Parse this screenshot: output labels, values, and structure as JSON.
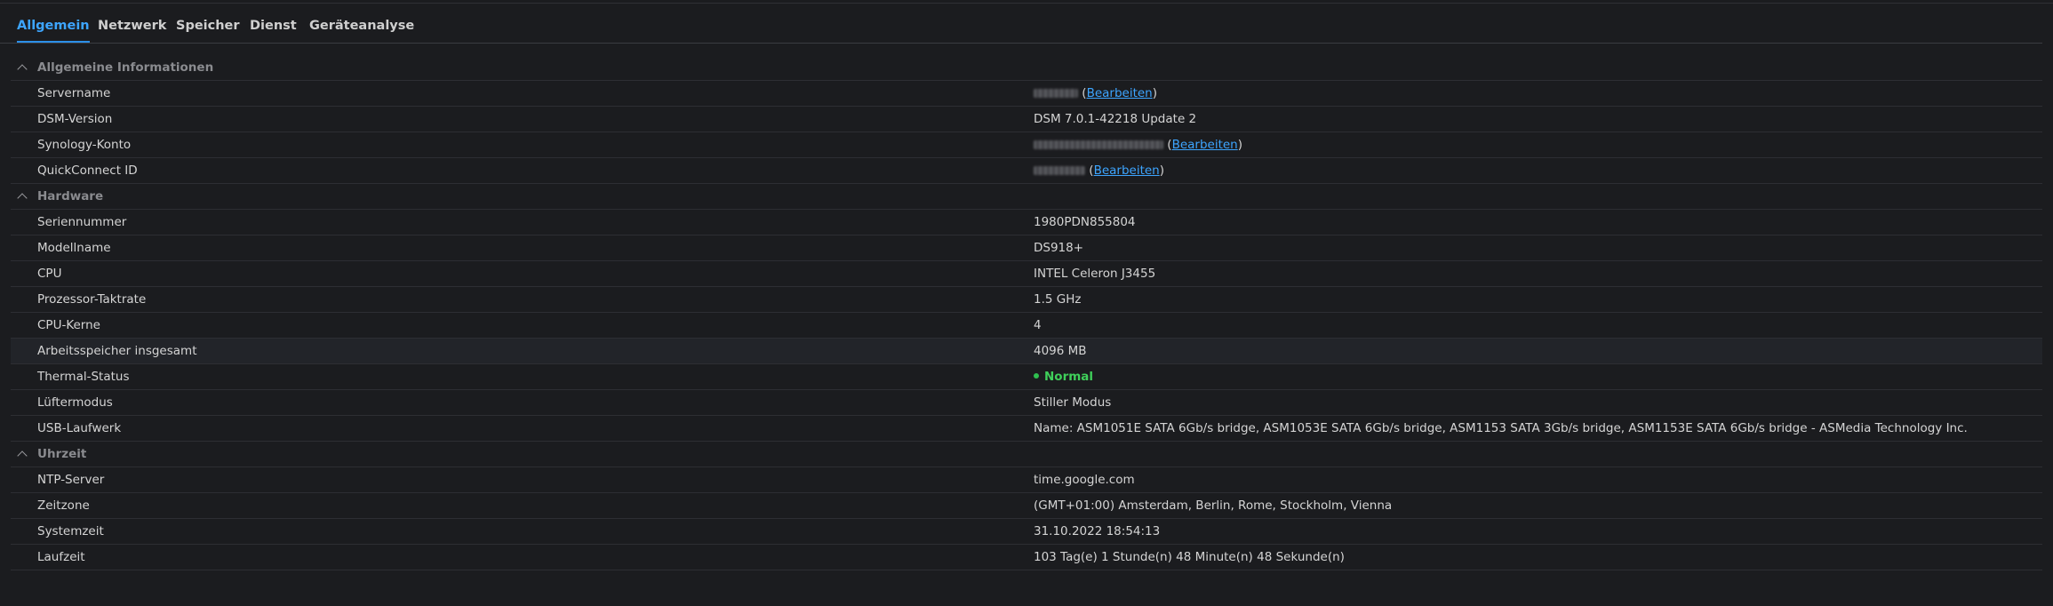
{
  "tabs": [
    {
      "label": "Allgemein",
      "active": true
    },
    {
      "label": "Netzwerk",
      "active": false
    },
    {
      "label": "Speicher",
      "active": false
    },
    {
      "label": "Dienst",
      "active": false
    },
    {
      "label": "Geräteanalyse",
      "active": false
    }
  ],
  "edit_label": "Bearbeiten",
  "sections": {
    "general": {
      "title": "Allgemeine Informationen",
      "rows": {
        "servername": {
          "label": "Servername"
        },
        "dsm": {
          "label": "DSM-Version",
          "value": "DSM 7.0.1-42218 Update 2"
        },
        "synology": {
          "label": "Synology-Konto"
        },
        "quickconnect": {
          "label": "QuickConnect ID"
        }
      }
    },
    "hardware": {
      "title": "Hardware",
      "rows": {
        "serial": {
          "label": "Seriennummer",
          "value": "1980PDN855804"
        },
        "model": {
          "label": "Modellname",
          "value": "DS918+"
        },
        "cpu": {
          "label": "CPU",
          "value": "INTEL Celeron J3455"
        },
        "clock": {
          "label": "Prozessor-Taktrate",
          "value": "1.5 GHz"
        },
        "cores": {
          "label": "CPU-Kerne",
          "value": "4"
        },
        "ram": {
          "label": "Arbeitsspeicher insgesamt",
          "value": "4096 MB"
        },
        "thermal": {
          "label": "Thermal-Status",
          "value": "Normal",
          "status_color": "#3fcf5a"
        },
        "fan": {
          "label": "Lüftermodus",
          "value": "Stiller Modus"
        },
        "usb": {
          "label": "USB-Laufwerk",
          "value": "Name: ASM1051E SATA 6Gb/s bridge, ASM1053E SATA 6Gb/s bridge, ASM1153 SATA 3Gb/s bridge, ASM1153E SATA 6Gb/s bridge - ASMedia Technology Inc."
        }
      }
    },
    "time": {
      "title": "Uhrzeit",
      "rows": {
        "ntp": {
          "label": "NTP-Server",
          "value": "time.google.com"
        },
        "tz": {
          "label": "Zeitzone",
          "value": "(GMT+01:00) Amsterdam, Berlin, Rome, Stockholm, Vienna"
        },
        "systime": {
          "label": "Systemzeit",
          "value": "31.10.2022 18:54:13"
        },
        "uptime": {
          "label": "Laufzeit",
          "value": "103 Tag(e) 1 Stunde(n) 48 Minute(n) 48 Sekunde(n)"
        }
      }
    }
  },
  "colors": {
    "accent": "#3da5ff",
    "background": "#1b1c1f",
    "status_ok": "#3fcf5a"
  }
}
